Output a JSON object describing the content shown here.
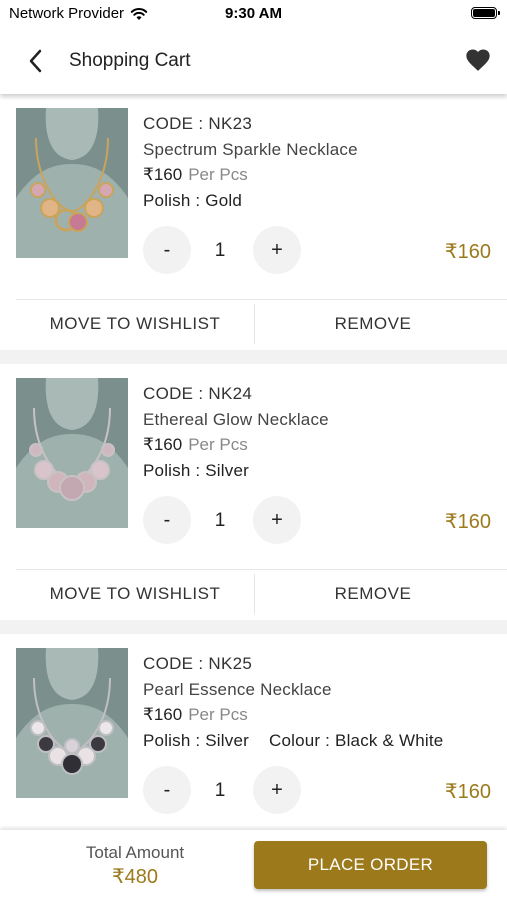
{
  "status_bar": {
    "carrier": "Network Provider",
    "time": "9:30 AM"
  },
  "header": {
    "title": "Shopping Cart"
  },
  "cart": {
    "items": [
      {
        "code": "CODE : NK23",
        "name": "Spectrum Sparkle Necklace",
        "price": "₹160",
        "unit": "Per Pcs",
        "polish": "Polish : Gold",
        "colour": "",
        "quantity": "1",
        "total": "₹160",
        "minus": "-",
        "plus": "+",
        "wishlist_label": "MOVE TO WISHLIST",
        "remove_label": "REMOVE",
        "metal_color": "#c9a45c"
      },
      {
        "code": "CODE : NK24",
        "name": "Ethereal Glow Necklace",
        "price": "₹160",
        "unit": "Per Pcs",
        "polish": "Polish : Silver",
        "colour": "",
        "quantity": "1",
        "total": "₹160",
        "minus": "-",
        "plus": "+",
        "wishlist_label": "MOVE TO WISHLIST",
        "remove_label": "REMOVE",
        "metal_color": "#c9c2c4"
      },
      {
        "code": "CODE : NK25",
        "name": "Pearl Essence Necklace",
        "price": "₹160",
        "unit": "Per Pcs",
        "polish": "Polish : Silver",
        "colour": "Colour : Black & White",
        "quantity": "1",
        "total": "₹160",
        "minus": "-",
        "plus": "+",
        "metal_color": "#bfbfc4"
      }
    ]
  },
  "footer": {
    "total_label": "Total Amount",
    "total_amount": "₹480",
    "place_order_label": "PLACE ORDER"
  },
  "colors": {
    "accent": "#9c7a1c",
    "page_bg": "#f2f2f2",
    "qty_button_bg": "#f2f2f2"
  },
  "icons": {
    "back": "chevron-left-icon",
    "wishlist": "heart-icon",
    "wifi": "wifi-icon",
    "battery": "battery-icon"
  }
}
